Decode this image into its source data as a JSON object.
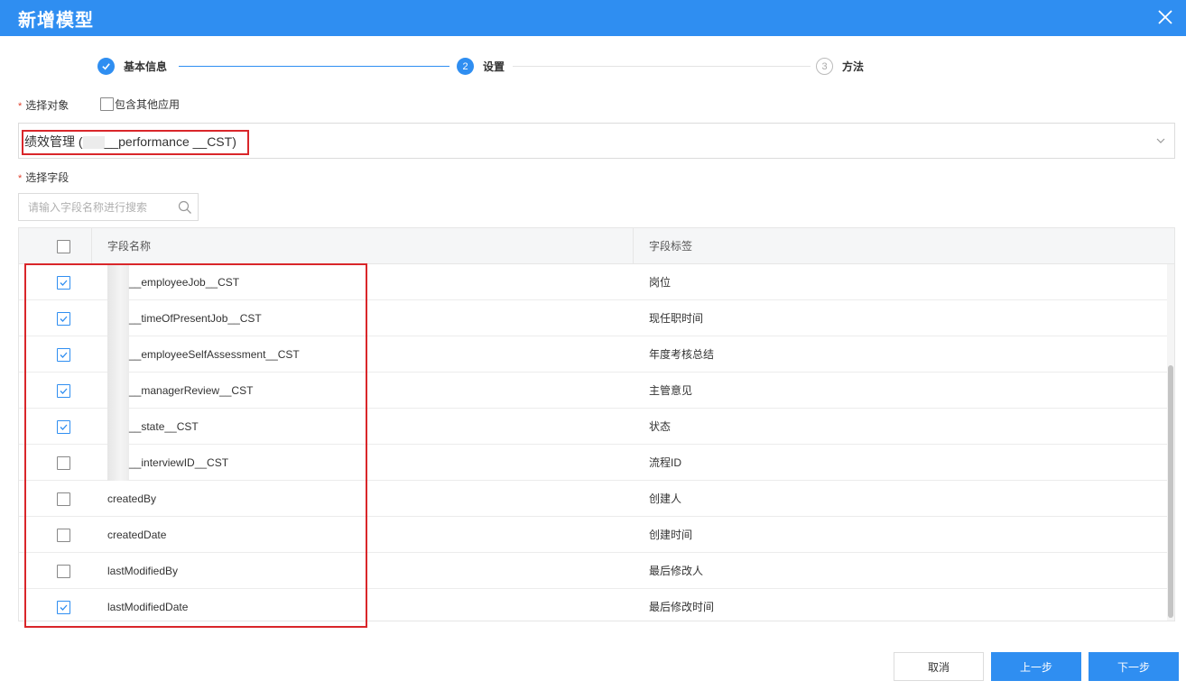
{
  "dialog": {
    "title": "新增模型"
  },
  "steps": [
    {
      "number": "1",
      "label": "基本信息",
      "status": "done"
    },
    {
      "number": "2",
      "label": "设置",
      "status": "active"
    },
    {
      "number": "3",
      "label": "方法",
      "status": "pending"
    }
  ],
  "object": {
    "label": "选择对象",
    "include_other_apps_label": "包含其他应用",
    "include_other_apps_checked": false,
    "selected_value": "绩效管理 (",
    "selected_value_suffix": "__performance __CST)"
  },
  "fields": {
    "label": "选择字段",
    "search_placeholder": "请输入字段名称进行搜索",
    "columns": {
      "name": "字段名称",
      "label": "字段标签"
    },
    "rows": [
      {
        "name": "__employeeJob__CST",
        "label": "岗位",
        "checked": true,
        "redacted_prefix": true
      },
      {
        "name": "__timeOfPresentJob__CST",
        "label": "现任职时间",
        "checked": true,
        "redacted_prefix": true
      },
      {
        "name": "__employeeSelfAssessment__CST",
        "label": "年度考核总结",
        "checked": true,
        "redacted_prefix": true
      },
      {
        "name": "__managerReview__CST",
        "label": "主管意见",
        "checked": true,
        "redacted_prefix": true
      },
      {
        "name": "__state__CST",
        "label": "状态",
        "checked": true,
        "redacted_prefix": true
      },
      {
        "name": "__interviewID__CST",
        "label": "流程ID",
        "checked": false,
        "redacted_prefix": true
      },
      {
        "name": "createdBy",
        "label": "创建人",
        "checked": false,
        "redacted_prefix": false
      },
      {
        "name": "createdDate",
        "label": "创建时间",
        "checked": false,
        "redacted_prefix": false
      },
      {
        "name": "lastModifiedBy",
        "label": "最后修改人",
        "checked": false,
        "redacted_prefix": false
      },
      {
        "name": "lastModifiedDate",
        "label": "最后修改时间",
        "checked": true,
        "redacted_prefix": false
      }
    ]
  },
  "footer": {
    "cancel_label": "取消",
    "prev_label": "上一步",
    "next_label": "下一步"
  },
  "colors": {
    "accent": "#2f8ef1",
    "highlight": "#d9262a",
    "required": "#e0422e"
  }
}
